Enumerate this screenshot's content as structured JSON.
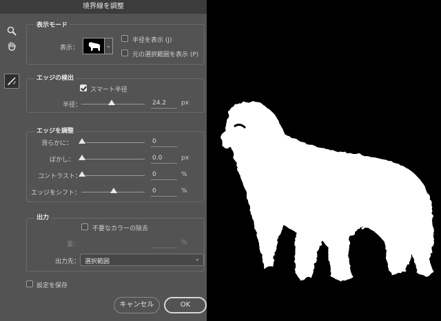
{
  "dialog": {
    "title": "境界線を調整",
    "view_mode": {
      "title": "表示モード",
      "view_label": "表示：",
      "show_radius": "半径を表示 (J)",
      "show_original": "元の選択範囲を表示 (P)"
    },
    "edge_detection": {
      "title": "エッジの検出",
      "smart_radius": "スマート半径",
      "smart_radius_checked": true,
      "radius_label": "半径：",
      "radius_value": "24.2",
      "radius_unit": "px"
    },
    "adjust_edge": {
      "title": "エッジを調整",
      "smooth_label": "滑らかに：",
      "smooth_value": "0",
      "feather_label": "ぼかし：",
      "feather_value": "0.0",
      "feather_unit": "px",
      "contrast_label": "コントラスト：",
      "contrast_value": "0",
      "contrast_unit": "%",
      "shift_label": "エッジをシフト：",
      "shift_value": "0",
      "shift_unit": "%"
    },
    "output": {
      "title": "出力",
      "decontaminate": "不要なカラーの除去",
      "amount_label": "量：",
      "amount_unit": "%",
      "output_to_label": "出力先：",
      "output_to_value": "選択範囲"
    },
    "remember_settings": "設定を保存",
    "cancel_label": "キャンセル",
    "ok_label": "OK"
  },
  "tools": [
    "zoom-icon",
    "hand-icon",
    "refine-radius-brush-icon"
  ],
  "colors": {
    "panel": "#535353",
    "titlebar": "#3c3c3c",
    "canvas": "#000000",
    "mask": "#ffffff"
  }
}
